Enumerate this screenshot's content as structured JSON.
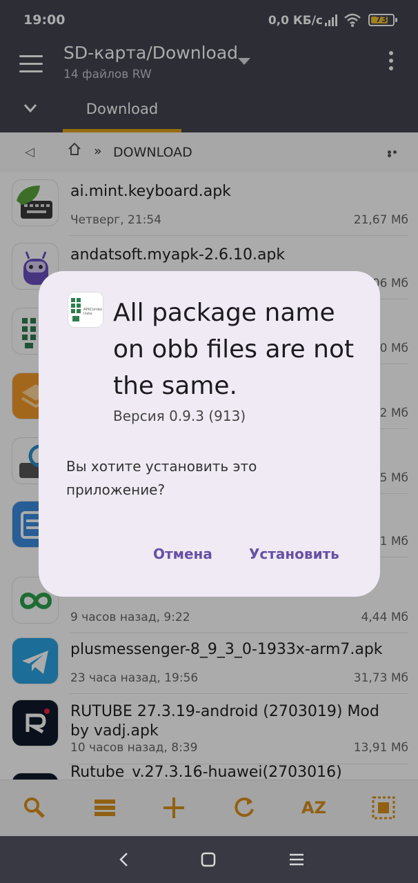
{
  "status": {
    "time": "19:00",
    "network": "0,0 КБ/с",
    "battery": "73"
  },
  "appbar": {
    "title": "SD-карта/Download",
    "subtitle": "14 файлов RW",
    "tab": "Download"
  },
  "path": {
    "crumb": "DOWNLOAD"
  },
  "files": [
    {
      "name": "ai.mint.keyboard.apk",
      "date": "Четверг, 21:54",
      "size": "21,67 Мб"
    },
    {
      "name": "andatsoft.myapk-2.6.10.apk",
      "date": "",
      "size": "06 Мб"
    },
    {
      "name": "",
      "date": "",
      "size": "0 Мб"
    },
    {
      "name": "",
      "date": "",
      "size": "2 Мб"
    },
    {
      "name": "",
      "date": "",
      "size": "5 Мб"
    },
    {
      "name": "",
      "date": "",
      "size": "1 Мб"
    },
    {
      "name": "",
      "date": "9 часов назад, 9:22",
      "size": "4,44 Мб"
    },
    {
      "name": "plusmessenger-8_9_3_0-1933x-arm7.apk",
      "date": "23 часа назад, 19:56",
      "size": "31,73 Мб"
    },
    {
      "name": "RUTUBE 27.3.19-android (2703019) Mod by vadj.apk",
      "date": "10 часов назад, 8:39",
      "size": "13,91 Мб"
    },
    {
      "name": "Rutube_v.27.3.16-huawei(2703016)",
      "date": "",
      "size": ""
    }
  ],
  "toolbar": {
    "sort_label": "AZ"
  },
  "dialog": {
    "icon_text": "APKCombo Insta",
    "title": "All package name on obb files are not the same.",
    "version": "Версия 0.9.3 (913)",
    "message": "Вы хотите установить это приложение?",
    "cancel": "Отмена",
    "install": "Установить"
  },
  "colors": {
    "appbar": "#42434f",
    "accent": "#e3a21a",
    "dialog_button": "#6750a4"
  }
}
